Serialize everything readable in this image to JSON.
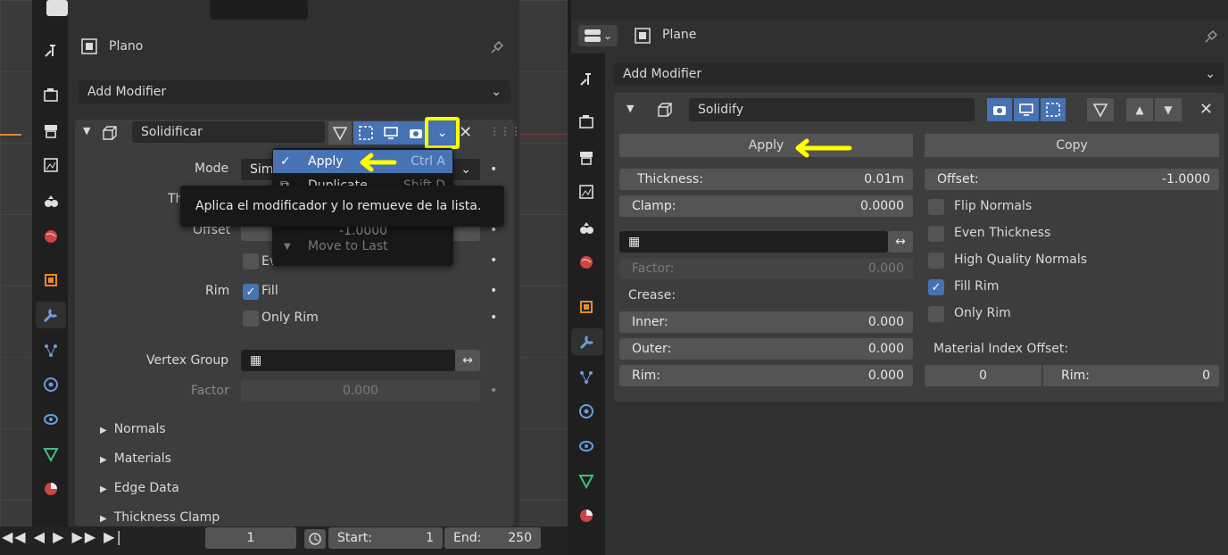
{
  "left_panel": {
    "object_name": "Plano",
    "add_modifier": "Add Modifier",
    "modifier_name": "Solidificar",
    "labels": {
      "mode": "Mode",
      "mode_value": "Sim",
      "thickness": "Thickness",
      "offset": "Offset",
      "rim": "Rim",
      "vertex_group": "Vertex Group",
      "factor": "Factor",
      "factor_value": "0.000"
    },
    "checkboxes": {
      "even_thickness": "Even Thickness",
      "fill": "Fill",
      "only_rim": "Only Rim"
    },
    "subpanels": [
      "Normals",
      "Materials",
      "Edge Data",
      "Thickness Clamp"
    ],
    "dropdown": {
      "apply": "Apply",
      "apply_shortcut": "Ctrl A",
      "duplicate": "Duplicate",
      "duplicate_shortcut": "Shift D",
      "hidden_value": "-1.0000",
      "move_to_last": "Move to Last"
    },
    "tooltip": "Aplica el modificador y lo remueve de la lista."
  },
  "timeline": {
    "frame": "1",
    "start_label": "Start:",
    "start_value": "1",
    "end_label": "End:",
    "end_value": "250"
  },
  "right_panel": {
    "object_name": "Plane",
    "add_modifier": "Add Modifier",
    "modifier_name": "Solidify",
    "apply": "Apply",
    "copy": "Copy",
    "thickness_label": "Thickness:",
    "thickness_value": "0.01m",
    "offset_label": "Offset:",
    "offset_value": "-1.0000",
    "clamp_label": "Clamp:",
    "clamp_value": "0.0000",
    "factor_label": "Factor:",
    "factor_value": "0.000",
    "crease_label": "Crease:",
    "inner_label": "Inner:",
    "inner_value": "0.000",
    "outer_label": "Outer:",
    "outer_value": "0.000",
    "rim_label": "Rim:",
    "rim_value": "0.000",
    "checks": {
      "flip_normals": "Flip Normals",
      "even_thickness": "Even Thickness",
      "high_quality_normals": "High Quality Normals",
      "fill_rim": "Fill Rim",
      "only_rim": "Only Rim"
    },
    "material_index_offset": "Material Index Offset:",
    "mat_offset_value": "0",
    "mat_rim_label": "Rim:",
    "mat_rim_value": "0"
  },
  "colors": {
    "accent": "#4772b3",
    "highlight": "#ffff00"
  }
}
